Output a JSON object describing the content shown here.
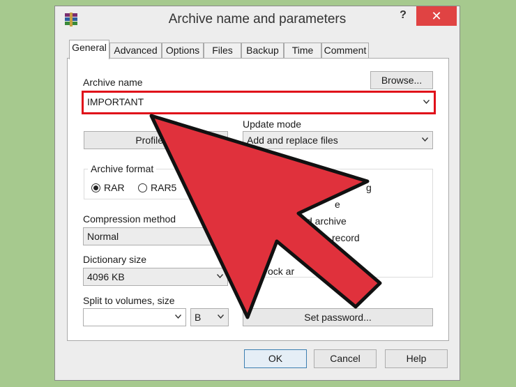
{
  "window": {
    "title": "Archive name and parameters",
    "help_label": "?",
    "close_label": "✕"
  },
  "tabs": [
    {
      "label": "General"
    },
    {
      "label": "Advanced"
    },
    {
      "label": "Options"
    },
    {
      "label": "Files"
    },
    {
      "label": "Backup"
    },
    {
      "label": "Time"
    },
    {
      "label": "Comment"
    }
  ],
  "general": {
    "archive_name_label": "Archive name",
    "browse_label": "Browse...",
    "archive_name_value": "IMPORTANT",
    "profiles_label": "Profiles...",
    "update_mode_label": "Update mode",
    "update_mode_value": "Add and replace files",
    "archive_format_label": "Archive format",
    "format_rar": "RAR",
    "format_rar5": "RAR5",
    "compression_label": "Compression method",
    "compression_value": "Normal",
    "dictionary_label": "Dictionary size",
    "dictionary_value": "4096 KB",
    "split_label": "Split to volumes, size",
    "split_value": "",
    "split_unit": "B",
    "set_password_label": "Set password...",
    "partial_options": [
      "g",
      "e",
      "d archive",
      "record",
      "ock ar"
    ]
  },
  "footer": {
    "ok_label": "OK",
    "cancel_label": "Cancel",
    "help_label": "Help"
  },
  "colors": {
    "background": "#a6c98e",
    "highlight_border": "#e0101a",
    "arrow_fill": "#e0313c",
    "close_button": "#e04343"
  },
  "overlay": {
    "icon": "arrow-pointer-icon"
  }
}
